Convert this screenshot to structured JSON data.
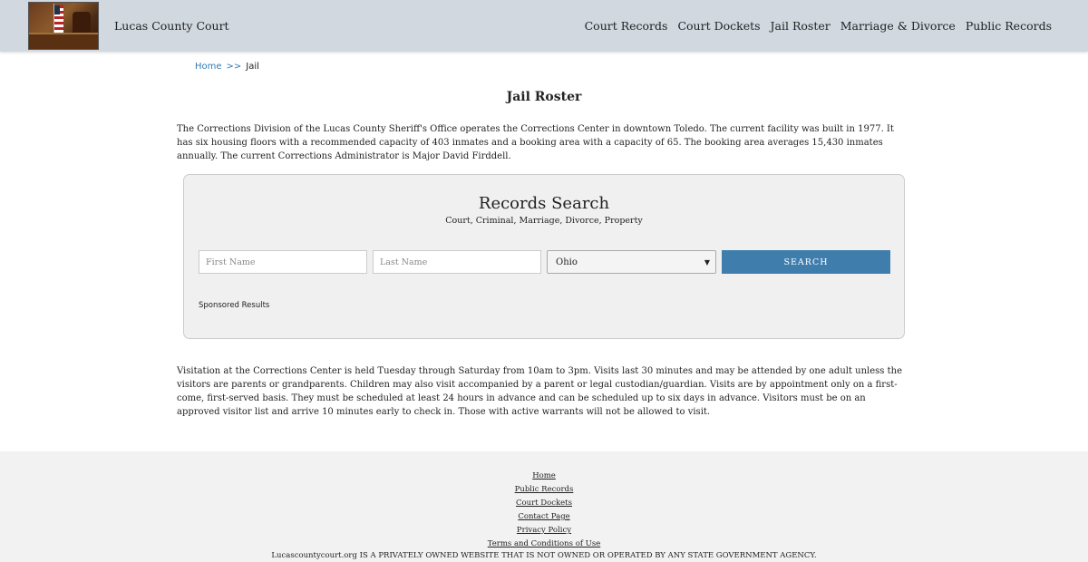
{
  "header": {
    "site_title": "Lucas County Court",
    "nav": [
      "Court Records",
      "Court Dockets",
      "Jail Roster",
      "Marriage & Divorce",
      "Public Records"
    ]
  },
  "breadcrumb": {
    "home": "Home",
    "separator": ">>",
    "current": "Jail"
  },
  "page_title": "Jail Roster",
  "intro": "The Corrections Division of the Lucas County Sheriff's Office operates the Corrections Center in downtown Toledo. The current facility was built in 1977. It has six housing floors with a recommended capacity of 403 inmates and a booking area with a capacity of 65. The booking area averages 15,430 inmates annually. The current Corrections Administrator is Major David Firddell.",
  "search": {
    "title": "Records Search",
    "subtitle": "Court, Criminal, Marriage, Divorce, Property",
    "first_name_placeholder": "First Name",
    "last_name_placeholder": "Last Name",
    "state_selected": "Ohio",
    "button_label": "SEARCH",
    "sponsored": "Sponsored Results"
  },
  "visitation": "Visitation at the Corrections Center is held Tuesday through Saturday from 10am to 3pm. Visits last 30 minutes and may be attended by one adult unless the visitors are parents or grandparents. Children may also visit accompanied by a parent or legal custodian/guardian. Visits are by appointment only on a first-come, first-served basis. They must be scheduled at least 24 hours in advance and can be scheduled up to six days in advance. Visitors must be on an approved visitor list and arrive 10 minutes early to check in. Those with active warrants will not be allowed to visit.",
  "footer": {
    "links": [
      "Home",
      "Public Records",
      "Court Dockets",
      "Contact Page",
      "Privacy Policy",
      "Terms and Conditions of Use"
    ],
    "disclaimer": "Lucascountycourt.org IS A PRIVATELY OWNED WEBSITE THAT IS NOT OWNED OR OPERATED BY ANY STATE GOVERNMENT AGENCY."
  },
  "colors": {
    "header_bg": "#d1d8e0",
    "button_bg": "#3f7dad",
    "link": "#337ab7"
  }
}
